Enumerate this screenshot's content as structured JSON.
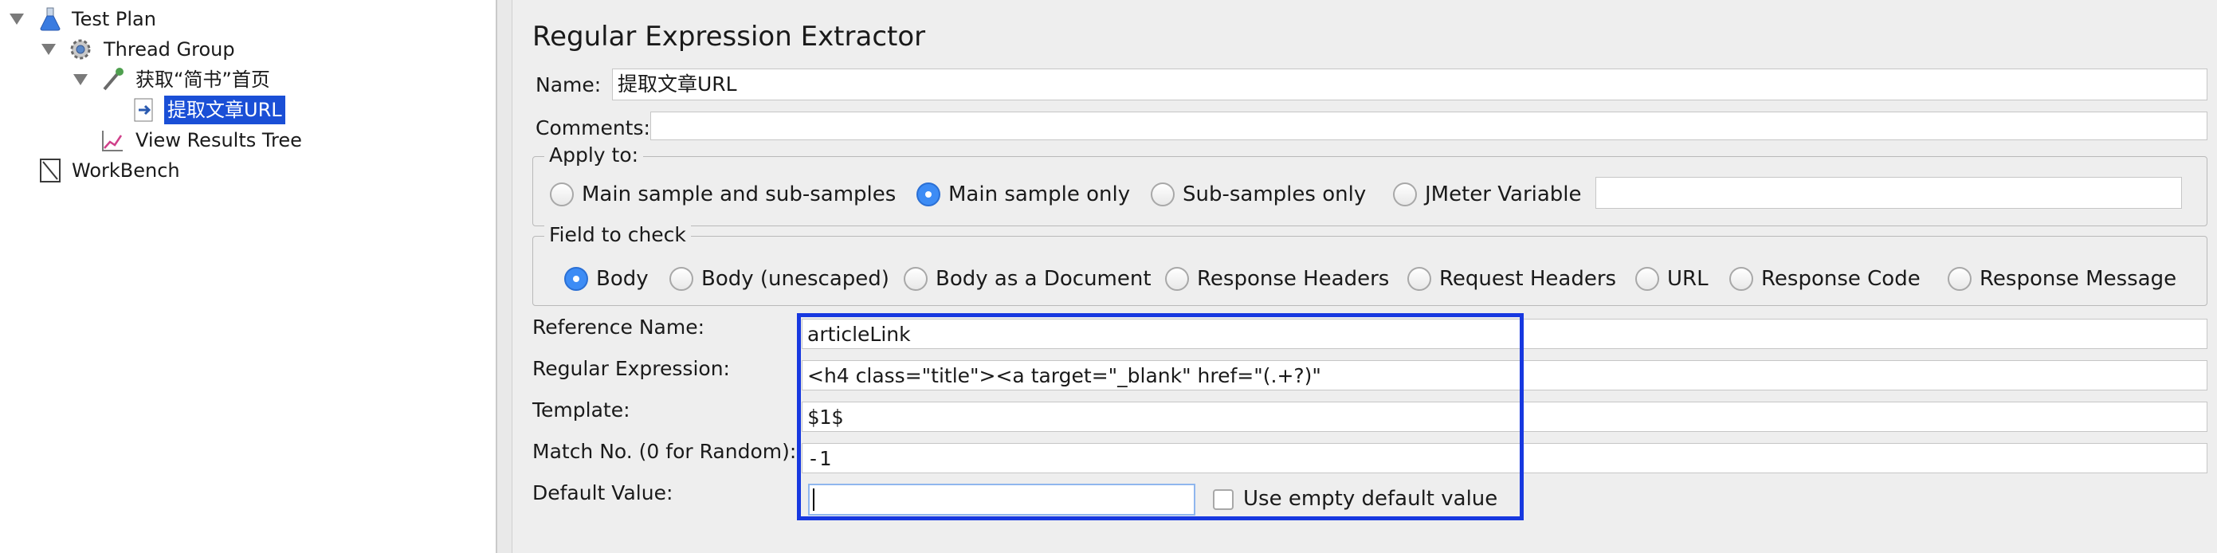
{
  "tree": {
    "items": [
      {
        "label": "Test Plan"
      },
      {
        "label": "Thread Group"
      },
      {
        "label": "获取“简书”首页"
      },
      {
        "label": "提取文章URL"
      },
      {
        "label": "View Results Tree"
      },
      {
        "label": "WorkBench"
      }
    ]
  },
  "panel": {
    "title": "Regular Expression Extractor",
    "name_label": "Name:",
    "name_value": "提取文章URL",
    "comments_label": "Comments:",
    "comments_value": "",
    "apply_to": {
      "title": "Apply to:",
      "options": [
        {
          "label": "Main sample and sub-samples",
          "selected": false
        },
        {
          "label": "Main sample only",
          "selected": true
        },
        {
          "label": "Sub-samples only",
          "selected": false
        },
        {
          "label": "JMeter Variable",
          "selected": false
        }
      ],
      "variable_value": ""
    },
    "field_to_check": {
      "title": "Field to check",
      "options": [
        {
          "label": "Body",
          "selected": true
        },
        {
          "label": "Body (unescaped)",
          "selected": false
        },
        {
          "label": "Body as a Document",
          "selected": false
        },
        {
          "label": "Response Headers",
          "selected": false
        },
        {
          "label": "Request Headers",
          "selected": false
        },
        {
          "label": "URL",
          "selected": false
        },
        {
          "label": "Response Code",
          "selected": false
        },
        {
          "label": "Response Message",
          "selected": false
        }
      ]
    },
    "reference_name_label": "Reference Name:",
    "reference_name_value": "articleLink",
    "regex_label": "Regular Expression:",
    "regex_value": "<h4 class=\"title\"><a target=\"_blank\" href=\"(.+?)\"",
    "template_label": "Template:",
    "template_value": "$1$",
    "match_no_label": "Match No. (0 for Random):",
    "match_no_value": "-1",
    "default_value_label": "Default Value:",
    "default_value_value": "",
    "use_empty_label": "Use empty default value",
    "use_empty_checked": false
  },
  "colors": {
    "selection": "#1a4fd6",
    "highlight_border": "#1738e0",
    "radio_selected": "#3d8cf5"
  }
}
